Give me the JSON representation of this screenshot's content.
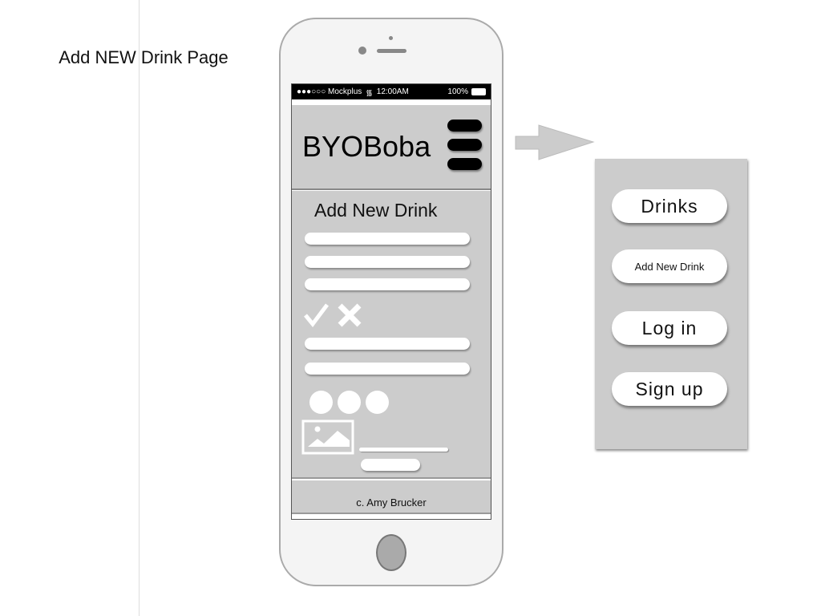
{
  "page_label": "Add NEW Drink Page",
  "status_bar": {
    "carrier": "●●●○○○ Mockplus",
    "time": "12:00AM",
    "battery": "100%"
  },
  "app": {
    "brand": "BYOBoba",
    "section_title": "Add New Drink",
    "footer": "c. Amy Brucker"
  },
  "menu": {
    "items": [
      "Drinks",
      "Add New Drink",
      "Log in",
      "Sign up"
    ]
  },
  "colors": {
    "panel": "#cccccc",
    "status_bar": "#000000"
  }
}
